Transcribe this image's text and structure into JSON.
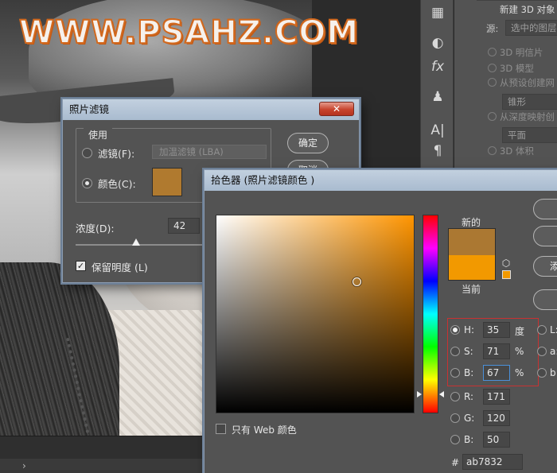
{
  "watermark": "WWW.PSAHZ.COM",
  "ps_panel": {
    "title": "新建 3D 对象",
    "source_label": "源:",
    "source_value": "选中的图层",
    "options": [
      "3D 明信片",
      "3D 模型",
      "从预设创建网",
      "从深度映射创",
      "3D 体积"
    ],
    "preset_value": "锥形",
    "depth_value": "平面",
    "toolbar_icons": [
      "grid-icon",
      "adjustment-icon",
      "fx-icon",
      "stamp-icon",
      "text-icon",
      "paragraph-icon"
    ]
  },
  "photo_filter": {
    "title": "照片滤镜",
    "close": "✕",
    "use_label": "使用",
    "filter_label": "滤镜(F):",
    "filter_value": "加温滤镜 (LBA)",
    "color_label": "颜色(C):",
    "color_swatch": "#b07a2f",
    "density_label": "浓度(D):",
    "density_value": "42",
    "density_percent": 42,
    "preserve_label": "保留明度 (L)",
    "ok_button": "确定",
    "cancel_button": "取消"
  },
  "color_picker": {
    "title": "拾色器 (照片滤镜颜色 )",
    "new_label": "新的",
    "current_label": "当前",
    "new_color": "#ab7832",
    "current_color": "#f29900",
    "web_only_label": "只有 Web 颜色",
    "hue_value": 35,
    "fields": {
      "h_label": "H:",
      "h_value": "35",
      "h_unit": "度",
      "s_label": "S:",
      "s_value": "71",
      "s_unit": "%",
      "b_label": "B:",
      "b_value": "67",
      "b_unit": "%",
      "r_label": "R:",
      "r_value": "171",
      "g_label": "G:",
      "g_value": "120",
      "b2_label": "B:",
      "b2_value": "50",
      "hex_label": "#",
      "hex_value": "ab7832",
      "l_label": "L:",
      "a_label": "a:",
      "bb_label": "b:"
    },
    "buttons": [
      "",
      "",
      "添",
      ""
    ]
  }
}
